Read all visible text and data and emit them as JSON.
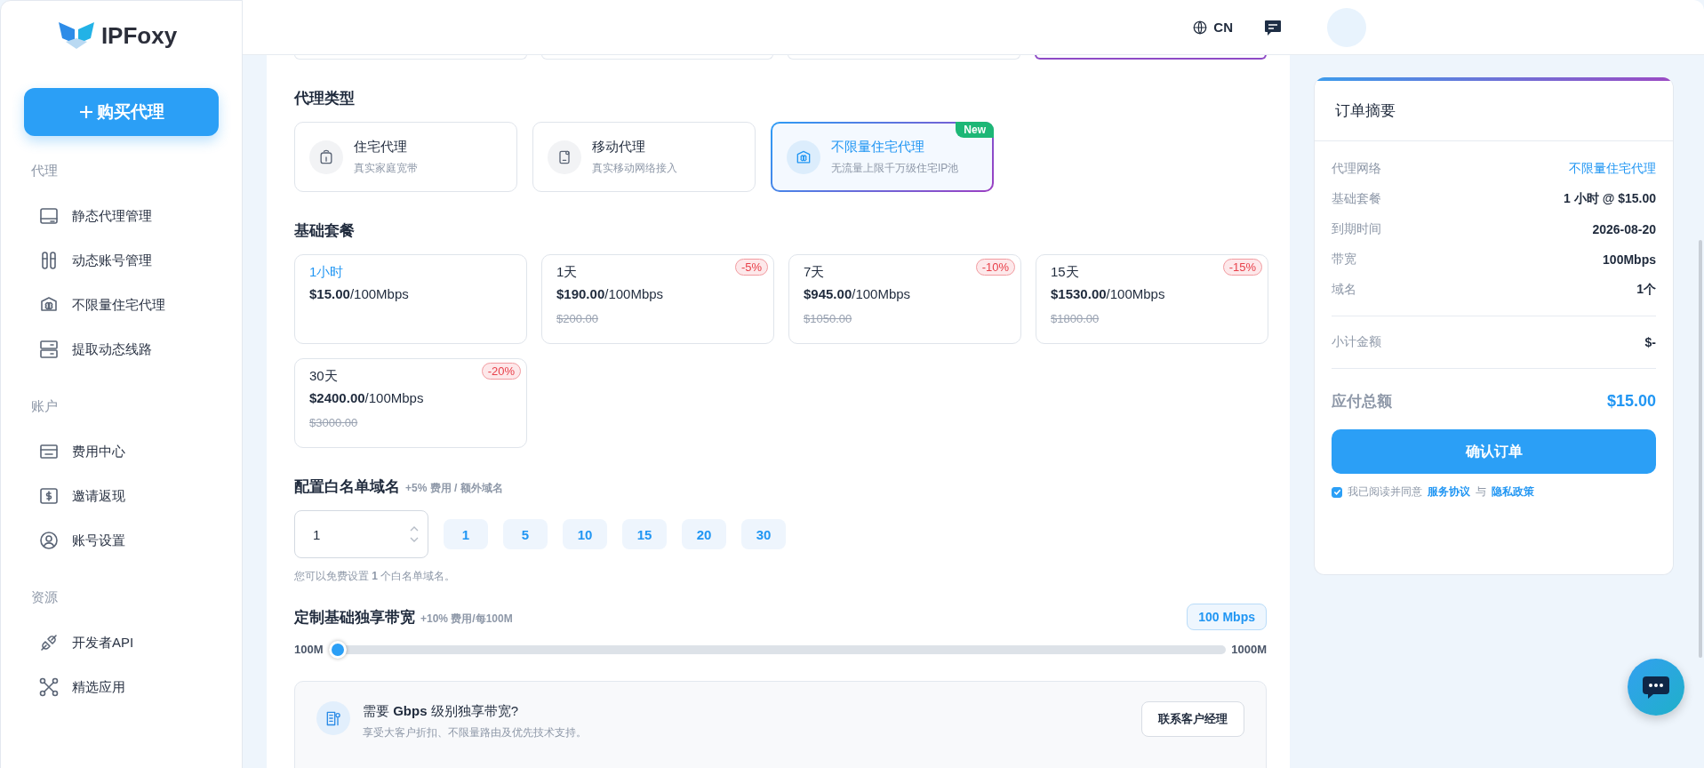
{
  "sidebar": {
    "logo": "IPFoxy",
    "buy_button": "购买代理",
    "sections": [
      {
        "title": "代理",
        "items": [
          {
            "label": "静态代理管理"
          },
          {
            "label": "动态账号管理"
          },
          {
            "label": "不限量住宅代理"
          },
          {
            "label": "提取动态线路"
          }
        ]
      },
      {
        "title": "账户",
        "items": [
          {
            "label": "费用中心"
          },
          {
            "label": "邀请返现"
          },
          {
            "label": "账号设置"
          }
        ]
      },
      {
        "title": "资源",
        "items": [
          {
            "label": "开发者API"
          },
          {
            "label": "精选应用"
          }
        ]
      }
    ]
  },
  "header": {
    "language": "CN"
  },
  "region_cards": [
    {
      "selected": false
    },
    {
      "selected": false
    },
    {
      "selected": false
    },
    {
      "selected": true
    }
  ],
  "proxy_type": {
    "title": "代理类型",
    "items": [
      {
        "title": "住宅代理",
        "subtitle": "真实家庭宽带",
        "selected": false
      },
      {
        "title": "移动代理",
        "subtitle": "真实移动网络接入",
        "selected": false
      },
      {
        "title": "不限量住宅代理",
        "subtitle": "无流量上限千万级住宅IP池",
        "selected": true,
        "badge": "New"
      }
    ]
  },
  "plans": {
    "title": "基础套餐",
    "items": [
      {
        "duration": "1小时",
        "price": "$15.00",
        "unit": "/100Mbps",
        "selected": true
      },
      {
        "duration": "1天",
        "price": "$190.00",
        "unit": "/100Mbps",
        "original": "$200.00",
        "discount": "-5%",
        "selected": false
      },
      {
        "duration": "7天",
        "price": "$945.00",
        "unit": "/100Mbps",
        "original": "$1050.00",
        "discount": "-10%",
        "selected": false
      },
      {
        "duration": "15天",
        "price": "$1530.00",
        "unit": "/100Mbps",
        "original": "$1800.00",
        "discount": "-15%",
        "selected": false
      },
      {
        "duration": "30天",
        "price": "$2400.00",
        "unit": "/100Mbps",
        "original": "$3000.00",
        "discount": "-20%",
        "selected": false
      }
    ]
  },
  "whitelist": {
    "title": "配置白名单域名",
    "note": "+5% 费用 / 额外域名",
    "value": "1",
    "presets": [
      "1",
      "5",
      "10",
      "15",
      "20",
      "30"
    ],
    "hint": "您可以免费设置 **1** 个白名单域名。"
  },
  "bandwidth": {
    "title": "定制基础独享带宽",
    "note": "+10% 费用/每100M",
    "badge": "100 Mbps",
    "min_label": "100M",
    "max_label": "1000M",
    "level": 0
  },
  "enterprise": {
    "title": "需要 **Gbps** 级别独享带宽?",
    "subtitle": "享受大客户折扣、不限量路由及优先技术支持。",
    "button": "联系客户经理"
  },
  "summary": {
    "title": "订单摘要",
    "rows": [
      {
        "label": "代理网络",
        "value": "不限量住宅代理",
        "accent": true
      },
      {
        "label": "基础套餐",
        "value": "1 小时 @ $15.00",
        "accent": false
      },
      {
        "label": "到期时间",
        "value": "2026-08-20",
        "accent": false
      },
      {
        "label": "带宽",
        "value": "100Mbps",
        "accent": false
      },
      {
        "label": "域名",
        "value": "1个",
        "accent": false
      }
    ],
    "subtotal": {
      "label": "小计金额",
      "value": "$-"
    },
    "total": {
      "label": "应付总额",
      "value": "$15.00"
    },
    "confirm_button": "确认订单",
    "agreement": {
      "checked": true,
      "text": "我已阅读并同意",
      "link_terms": "服务协议",
      "joiner": "与",
      "link_privacy": "隐私政策"
    }
  }
}
